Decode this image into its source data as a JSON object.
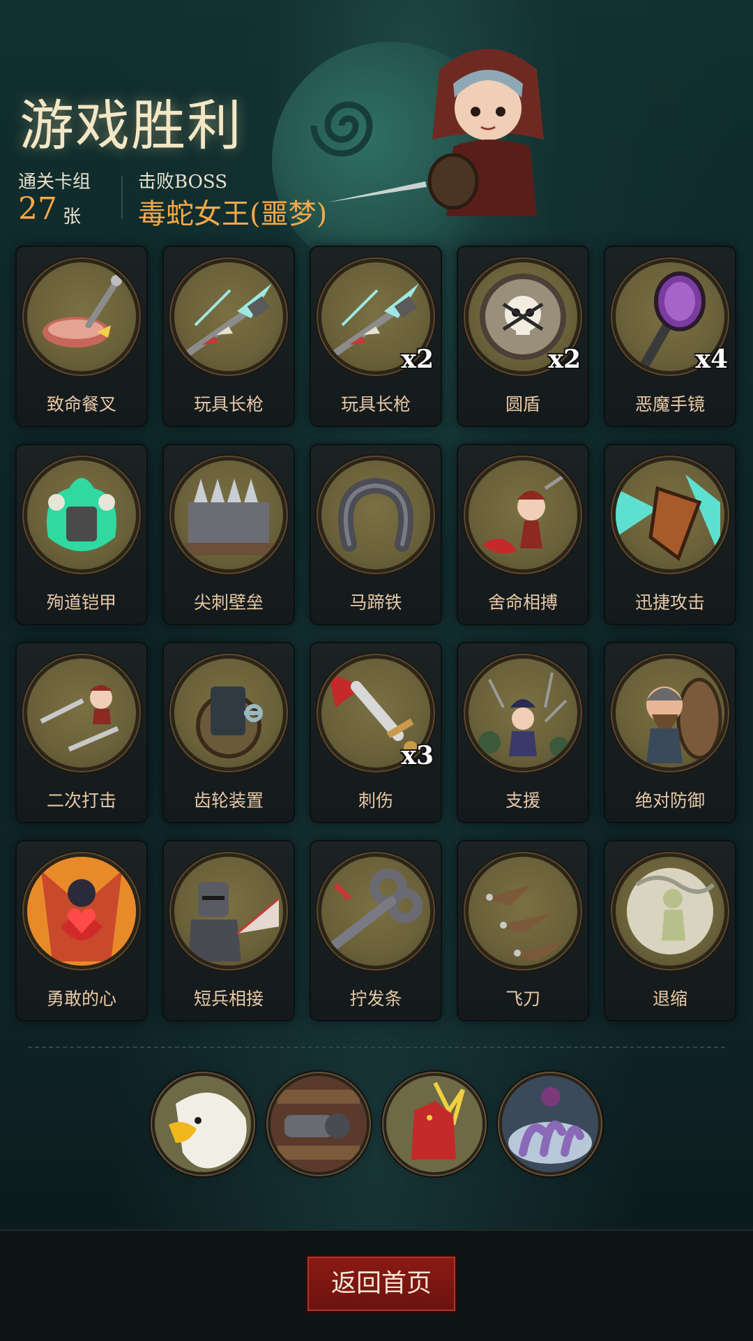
{
  "header": {
    "title": "游戏胜利",
    "deck_label": "通关卡组",
    "deck_count": "27",
    "deck_unit": "张",
    "boss_label": "击败BOSS",
    "boss_name": "毒蛇女王(噩梦)"
  },
  "cards": [
    {
      "name": "致命餐叉",
      "count": "",
      "icon": "fork-steak-icon"
    },
    {
      "name": "玩具长枪",
      "count": "",
      "icon": "toy-lance-icon"
    },
    {
      "name": "玩具长枪",
      "count": "x2",
      "icon": "toy-lance-icon"
    },
    {
      "name": "圆盾",
      "count": "x2",
      "icon": "skull-shield-icon"
    },
    {
      "name": "恶魔手镜",
      "count": "x4",
      "icon": "demon-mirror-icon"
    },
    {
      "name": "殉道铠甲",
      "count": "",
      "icon": "ghost-armor-icon"
    },
    {
      "name": "尖刺壁垒",
      "count": "",
      "icon": "spike-wall-icon"
    },
    {
      "name": "马蹄铁",
      "count": "",
      "icon": "horseshoe-icon"
    },
    {
      "name": "舍命相搏",
      "count": "",
      "icon": "desperate-fight-icon"
    },
    {
      "name": "迅捷攻击",
      "count": "",
      "icon": "swift-attack-icon"
    },
    {
      "name": "二次打击",
      "count": "",
      "icon": "double-strike-icon"
    },
    {
      "name": "齿轮装置",
      "count": "",
      "icon": "gear-device-icon"
    },
    {
      "name": "刺伤",
      "count": "x3",
      "icon": "dagger-stab-icon"
    },
    {
      "name": "支援",
      "count": "",
      "icon": "support-icon"
    },
    {
      "name": "绝对防御",
      "count": "",
      "icon": "viking-shield-icon"
    },
    {
      "name": "勇敢的心",
      "count": "",
      "icon": "brave-heart-icon"
    },
    {
      "name": "短兵相接",
      "count": "",
      "icon": "knight-clash-icon"
    },
    {
      "name": "拧发条",
      "count": "",
      "icon": "wind-up-key-icon"
    },
    {
      "name": "飞刀",
      "count": "",
      "icon": "flying-knives-icon"
    },
    {
      "name": "退缩",
      "count": "",
      "icon": "retreat-icon"
    }
  ],
  "relics": [
    {
      "icon": "eagle-icon"
    },
    {
      "icon": "cannon-icon"
    },
    {
      "icon": "red-demon-icon"
    },
    {
      "icon": "tentacle-icon"
    }
  ],
  "footer": {
    "home_button": "返回首页"
  },
  "colors": {
    "accent": "#f5a94a",
    "card_label": "#e9c9a6",
    "button": "#7c1711"
  }
}
